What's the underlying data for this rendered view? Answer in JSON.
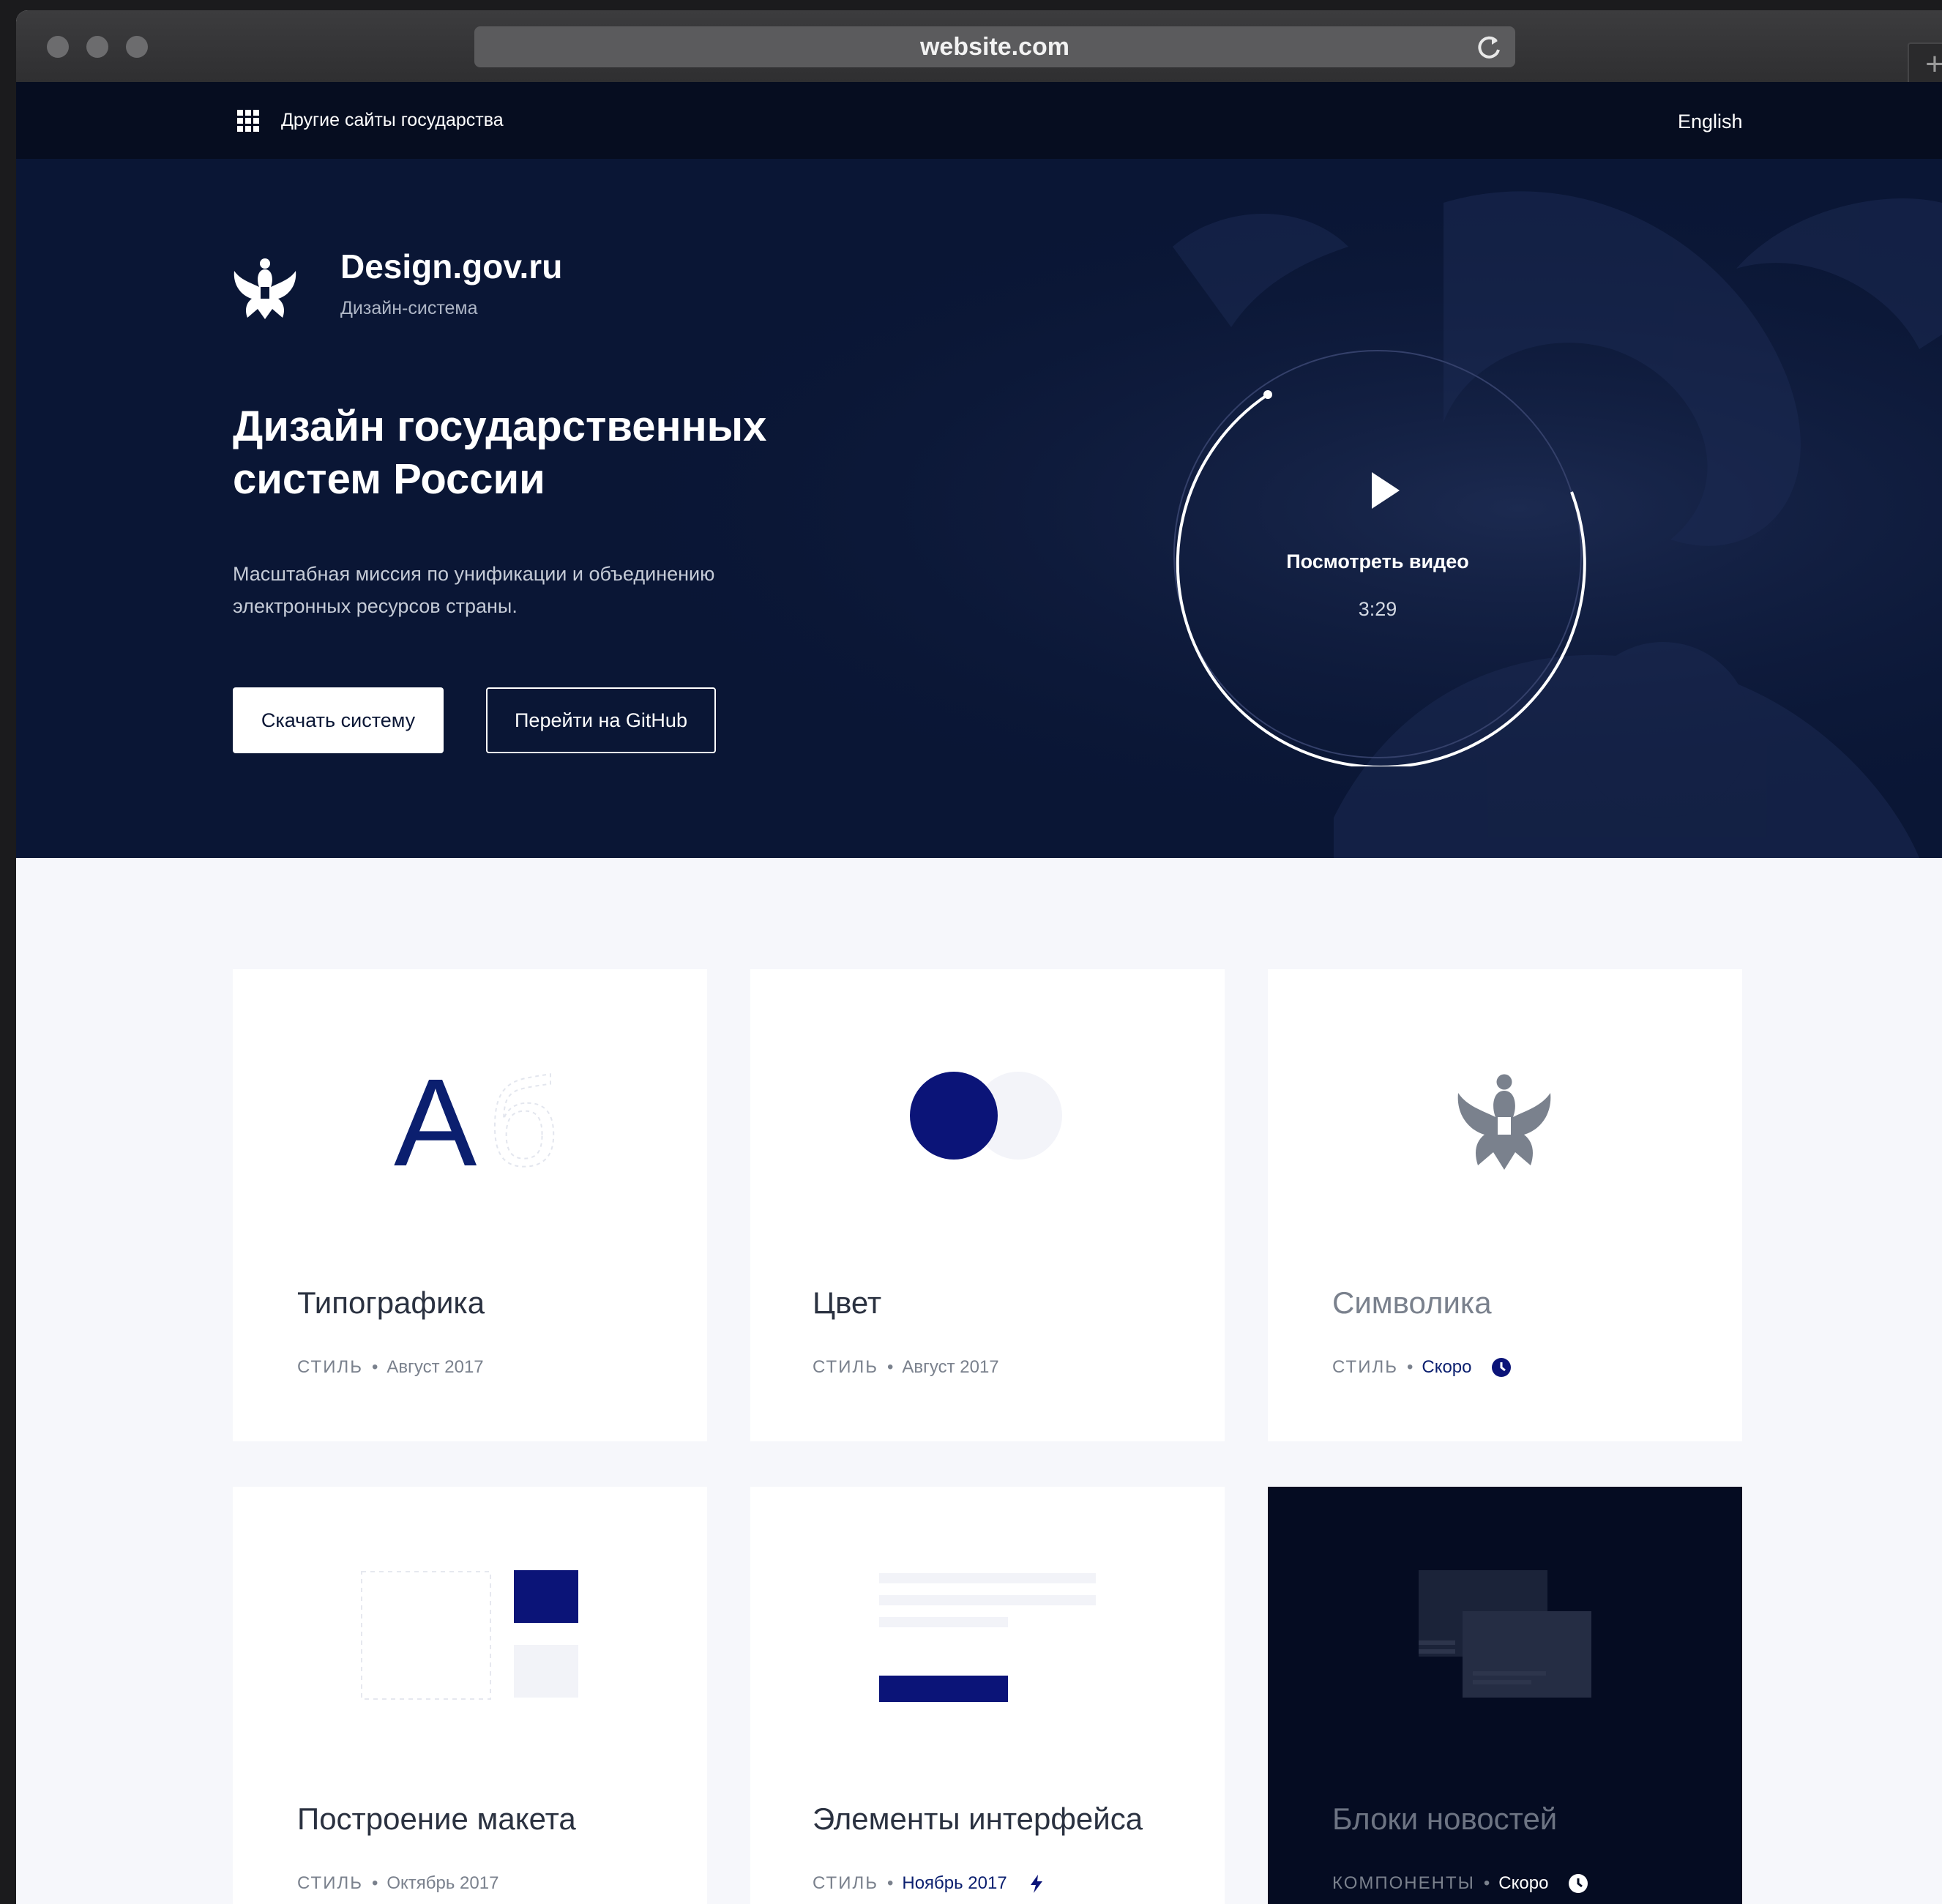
{
  "browser": {
    "url": "website.com"
  },
  "topnav": {
    "other_sites": "Другие сайты государства",
    "language": "English"
  },
  "hero": {
    "brand": "Design.gov.ru",
    "brand_sub": "Дизайн-система",
    "title": "Дизайн государственных систем России",
    "lead": "Масштабная миссия по унификации и объединению электронных ресурсов страны.",
    "btn_download": "Скачать систему",
    "btn_github": "Перейти на GitHub",
    "video_label": "Посмотреть видео",
    "video_time": "3:29"
  },
  "cards": [
    {
      "title": "Типографика",
      "category": "СТИЛЬ",
      "date": "Август 2017",
      "preview_letters": [
        "А",
        "б"
      ]
    },
    {
      "title": "Цвет",
      "category": "СТИЛЬ",
      "date": "Август 2017"
    },
    {
      "title": "Символика",
      "category": "СТИЛЬ",
      "date": "Скоро"
    },
    {
      "title": "Построение макета",
      "category": "СТИЛЬ",
      "date": "Октябрь 2017"
    },
    {
      "title": "Элементы интерфейса",
      "category": "СТИЛЬ",
      "date": "Ноябрь 2017"
    },
    {
      "title": "Блоки новостей",
      "category": "КОМПОНЕНТЫ",
      "date": "Скоро"
    }
  ],
  "colors": {
    "navy": "#0a1635",
    "accent": "#0b1f6f",
    "page_bg": "#f6f7fb"
  }
}
